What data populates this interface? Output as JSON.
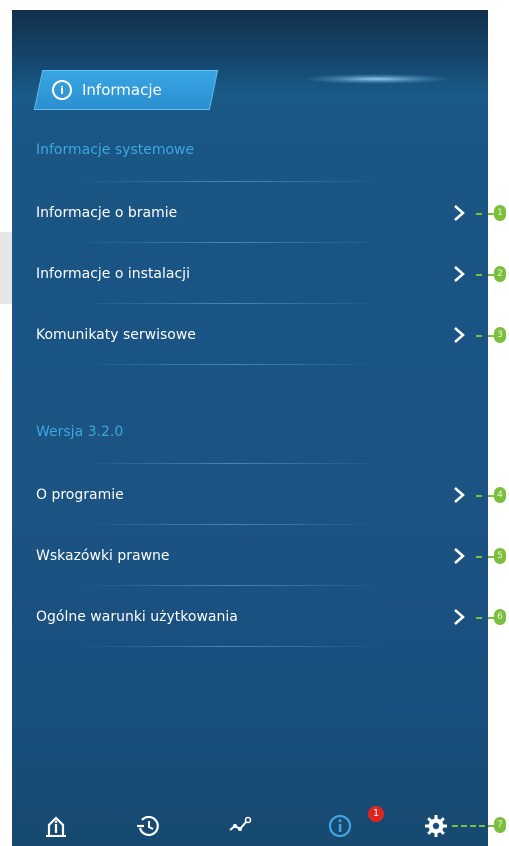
{
  "header": {
    "tab_label": "Informacje",
    "tab_icon": "info-icon"
  },
  "sections": [
    {
      "title": "Informacje systemowe",
      "items": [
        {
          "label": "Informacje o bramie",
          "callout": "1"
        },
        {
          "label": "Informacje o instalacji",
          "callout": "2"
        },
        {
          "label": "Komunikaty serwisowe",
          "callout": "3"
        }
      ]
    },
    {
      "title": "Wersja 3.2.0",
      "items": [
        {
          "label": "O programie",
          "callout": "4"
        },
        {
          "label": "Wskazówki prawne",
          "callout": "5"
        },
        {
          "label": "Ogólne warunki użytkowania",
          "callout": "6"
        }
      ]
    }
  ],
  "bottom_nav": {
    "items": [
      "home-icon",
      "history-icon",
      "graph-icon",
      "info-icon",
      "settings-icon"
    ],
    "badge": "1",
    "callout": "7"
  },
  "colors": {
    "background": "#1b5383",
    "accent": "#3ea6e0",
    "callout": "#7cbf3e",
    "badge": "#e2251c"
  }
}
